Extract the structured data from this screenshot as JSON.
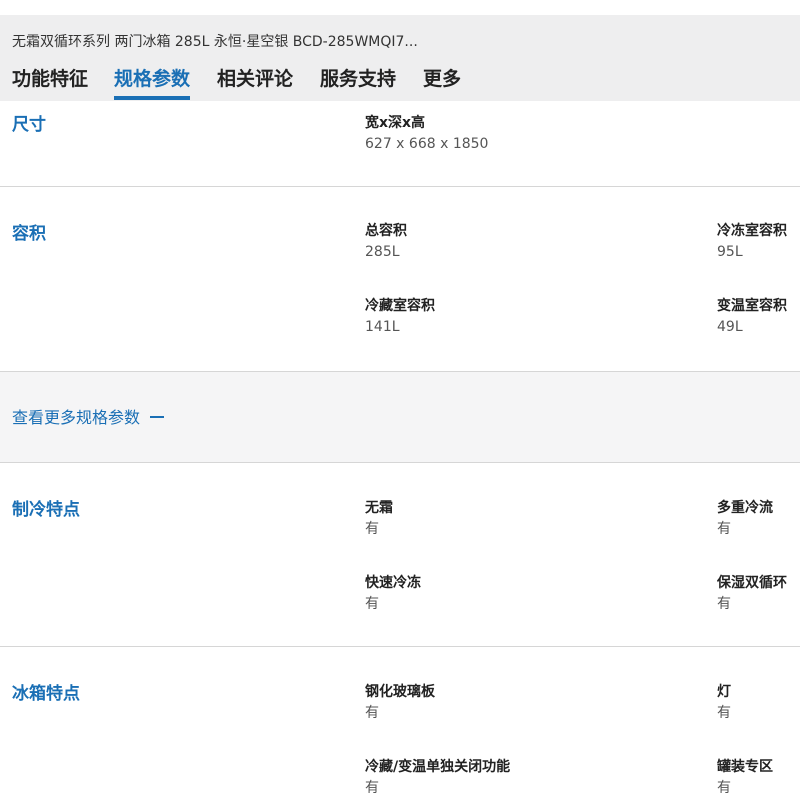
{
  "header": {
    "product_title": "无霜双循环系列 两门冰箱 285L 永恒·星空银 BCD-285WMQI7...",
    "tabs": [
      {
        "label": "功能特征"
      },
      {
        "label": "规格参数"
      },
      {
        "label": "相关评论"
      },
      {
        "label": "服务支持"
      },
      {
        "label": "更多"
      }
    ],
    "active_tab": "规格参数"
  },
  "sections": {
    "size": {
      "title": "尺寸",
      "specs": [
        {
          "label": "宽x深x高",
          "value": "627 x 668 x 1850"
        }
      ]
    },
    "capacity": {
      "title": "容积",
      "specs": [
        {
          "label": "总容积",
          "value": "285L"
        },
        {
          "label": "冷冻室容积",
          "value": "95L"
        },
        {
          "label": "冷藏室容积",
          "value": "141L"
        },
        {
          "label": "变温室容积",
          "value": "49L"
        }
      ]
    },
    "more": {
      "label": "查看更多规格参数"
    },
    "cooling": {
      "title": "制冷特点",
      "specs": [
        {
          "label": "无霜",
          "value": "有"
        },
        {
          "label": "多重冷流",
          "value": "有"
        },
        {
          "label": "快速冷冻",
          "value": "有"
        },
        {
          "label": "保湿双循环",
          "value": "有"
        }
      ]
    },
    "fridge": {
      "title": "冰箱特点",
      "specs": [
        {
          "label": "钢化玻璃板",
          "value": "有"
        },
        {
          "label": "灯",
          "value": "有"
        },
        {
          "label": "冷藏/变温单独关闭功能",
          "value": "有"
        },
        {
          "label": "罐装专区",
          "value": "有"
        }
      ]
    }
  },
  "colors": {
    "accent": "#1a6fb5",
    "header_bg": "#eeeeef",
    "divider": "#d6d6d6"
  }
}
